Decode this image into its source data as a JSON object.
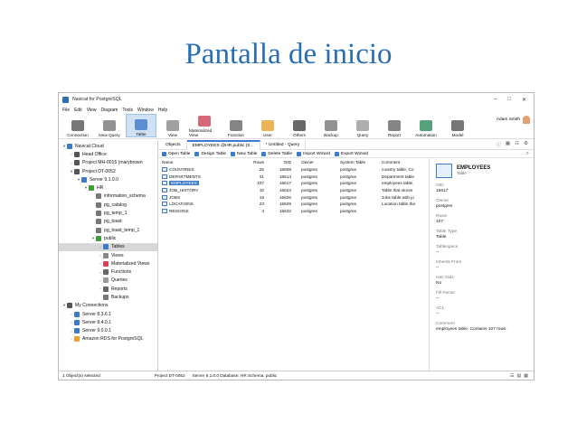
{
  "slide": {
    "title": "Pantalla de inicio"
  },
  "window": {
    "title": "Navicat for PostgreSQL",
    "controls": [
      "–",
      "□",
      "✕"
    ]
  },
  "menu": [
    "File",
    "Edit",
    "View",
    "Diagram",
    "Tools",
    "Window",
    "Help"
  ],
  "toolbar": {
    "buttons": [
      {
        "label": "Connection",
        "color": "#555"
      },
      {
        "label": "New Query",
        "color": "#777"
      },
      {
        "label": "Table",
        "color": "#3d7bc8",
        "active": true
      },
      {
        "label": "View",
        "color": "#888"
      },
      {
        "label": "Materialized View",
        "color": "#c45"
      },
      {
        "label": "Function",
        "color": "#666"
      },
      {
        "label": "User",
        "color": "#e8a030"
      },
      {
        "label": "Others",
        "color": "#444"
      },
      {
        "label": "Backup",
        "color": "#777"
      },
      {
        "label": "Query",
        "color": "#999"
      },
      {
        "label": "Report",
        "color": "#666"
      },
      {
        "label": "Automation",
        "color": "#2a8a5a"
      },
      {
        "label": "Model",
        "color": "#555"
      }
    ],
    "user": "Adam Smith"
  },
  "nav": [
    {
      "label": "Navicat Cloud",
      "lvl": 0,
      "arrow": "▾",
      "color": "#3d7bc8"
    },
    {
      "label": "Head Office",
      "lvl": 1,
      "arrow": "›",
      "color": "#555"
    },
    {
      "label": "Project MH-0015 (marybrown",
      "lvl": 1,
      "arrow": "›",
      "color": "#555"
    },
    {
      "label": "Project DT-0052",
      "lvl": 1,
      "arrow": "▾",
      "color": "#555"
    },
    {
      "label": "Server 9.1.0.0",
      "lvl": 2,
      "arrow": "▾",
      "color": "#3d7bc8"
    },
    {
      "label": "HR",
      "lvl": 3,
      "arrow": "▾",
      "color": "#3a9d3a"
    },
    {
      "label": "information_schema",
      "lvl": 4,
      "arrow": "",
      "color": "#777"
    },
    {
      "label": "pg_catalog",
      "lvl": 4,
      "arrow": "",
      "color": "#777"
    },
    {
      "label": "pg_temp_1",
      "lvl": 4,
      "arrow": "",
      "color": "#777"
    },
    {
      "label": "pg_toast",
      "lvl": 4,
      "arrow": "",
      "color": "#777"
    },
    {
      "label": "pg_toast_temp_1",
      "lvl": 4,
      "arrow": "",
      "color": "#777"
    },
    {
      "label": "public",
      "lvl": 4,
      "arrow": "▾",
      "color": "#3a9d3a"
    },
    {
      "label": "Tables",
      "lvl": 5,
      "arrow": "›",
      "color": "#3d7bc8",
      "sel": true
    },
    {
      "label": "Views",
      "lvl": 5,
      "arrow": "›",
      "color": "#888"
    },
    {
      "label": "Materialized Views",
      "lvl": 5,
      "arrow": "›",
      "color": "#c45"
    },
    {
      "label": "Functions",
      "lvl": 5,
      "arrow": "›",
      "color": "#666"
    },
    {
      "label": "Queries",
      "lvl": 5,
      "arrow": "›",
      "color": "#999"
    },
    {
      "label": "Reports",
      "lvl": 5,
      "arrow": "›",
      "color": "#666"
    },
    {
      "label": "Backups",
      "lvl": 5,
      "arrow": "",
      "color": "#777"
    },
    {
      "label": "My Connections",
      "lvl": 0,
      "arrow": "▾",
      "color": "#555"
    },
    {
      "label": "Server 8.3.6.1",
      "lvl": 1,
      "arrow": "›",
      "color": "#3d7bc8"
    },
    {
      "label": "Server 8.4.0.1",
      "lvl": 1,
      "arrow": "›",
      "color": "#3d7bc8"
    },
    {
      "label": "Server 9.0.0.1",
      "lvl": 1,
      "arrow": "›",
      "color": "#3d7bc8"
    },
    {
      "label": "Amazon RDS for PostgreSQL",
      "lvl": 1,
      "arrow": "›",
      "color": "#e8a030"
    }
  ],
  "tabs": [
    "Objects",
    "EMPLOYEES @HR.public (S...",
    "* Untitled - Query"
  ],
  "objbar": [
    "Open Table",
    "Design Table",
    "New Table",
    "Delete Table",
    "Import Wizard",
    "Export Wizard"
  ],
  "table": {
    "headers": [
      "Name",
      "Rows",
      "OID",
      "Owner",
      "System Table",
      "Comment"
    ],
    "rows": [
      [
        "COUNTRIES",
        "25",
        "16608",
        "postgres",
        "postgres",
        "country table. Co"
      ],
      [
        "DEPARTMENTS",
        "31",
        "16614",
        "postgres",
        "postgres",
        "Department table"
      ],
      [
        "EMPLOYEES",
        "107",
        "16617",
        "postgres",
        "postgres",
        "employees table."
      ],
      [
        "JOB_HISTORY",
        "10",
        "16623",
        "postgres",
        "postgres",
        "Table that stores"
      ],
      [
        "JOBS",
        "19",
        "16626",
        "postgres",
        "postgres",
        "Jobs table with jo"
      ],
      [
        "LOCATIONS",
        "23",
        "16629",
        "postgres",
        "postgres",
        "Location table tha"
      ],
      [
        "REGIONS",
        "4",
        "16632",
        "postgres",
        "postgres",
        ""
      ]
    ],
    "selected": 2
  },
  "detail": {
    "name": "EMPLOYEES",
    "type": "Table",
    "props": [
      [
        "OID",
        "16617"
      ],
      [
        "Owner",
        "postgres"
      ],
      [
        "Rows",
        "107"
      ],
      [
        "Table Type",
        "Table"
      ],
      [
        "Tablespace",
        "--"
      ],
      [
        "Inherits From",
        "--"
      ],
      [
        "Has Oids",
        "No"
      ],
      [
        "Fill Factor",
        "--"
      ],
      [
        "ACL",
        "--"
      ],
      [
        "Comment",
        "employees table. Contains 107 rows."
      ]
    ]
  },
  "status": {
    "left": "1 Object(s) selected",
    "project": "Project DT-0052",
    "server": "Server 9.1.0.0  Database: HR  Schema: public"
  }
}
